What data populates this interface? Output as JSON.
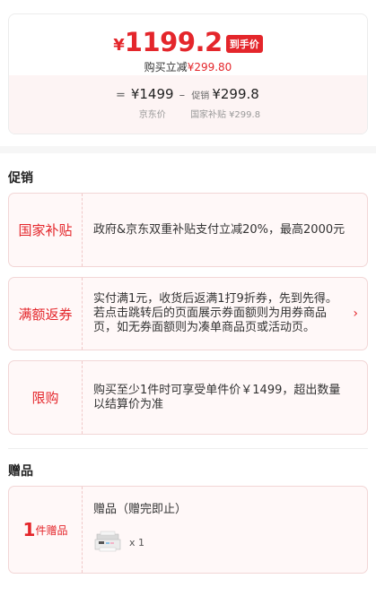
{
  "price": {
    "currency": "¥",
    "final_price": "1199.2",
    "tag": "到手价",
    "sub_prefix": "购买立减",
    "sub_amount": "¥299.80",
    "formula": {
      "equals": "=",
      "jd_value": "¥1499",
      "jd_label": "京东价",
      "minus": "–",
      "promo_prefix": "促销",
      "promo_value": "¥299.8",
      "subsidy_label": "国家补贴",
      "subsidy_value": "¥299.8"
    }
  },
  "promotions": {
    "title": "促销",
    "items": [
      {
        "tag": "国家补贴",
        "text": "政府&京东双重补贴支付立减20%，最高2000元"
      },
      {
        "tag": "满额返券",
        "text": "实付满1元，收货后返满1打9折券，先到先得。若点击跳转后的页面展示券面额则为用券商品页，如无券面额则为凑单商品页或活动页。",
        "arrow": "›"
      },
      {
        "tag": "限购",
        "text": "购买至少1件时可享受单件价￥1499，超出数量以结算价为准"
      }
    ]
  },
  "gifts": {
    "title": "赠品",
    "count": "1",
    "count_label": "件赠品",
    "item_title": "赠品（赠完即止）",
    "qty": "x 1"
  },
  "colors": {
    "accent": "#e4262b",
    "card_bg": "#fff8f8",
    "border": "#f2d6d6"
  }
}
